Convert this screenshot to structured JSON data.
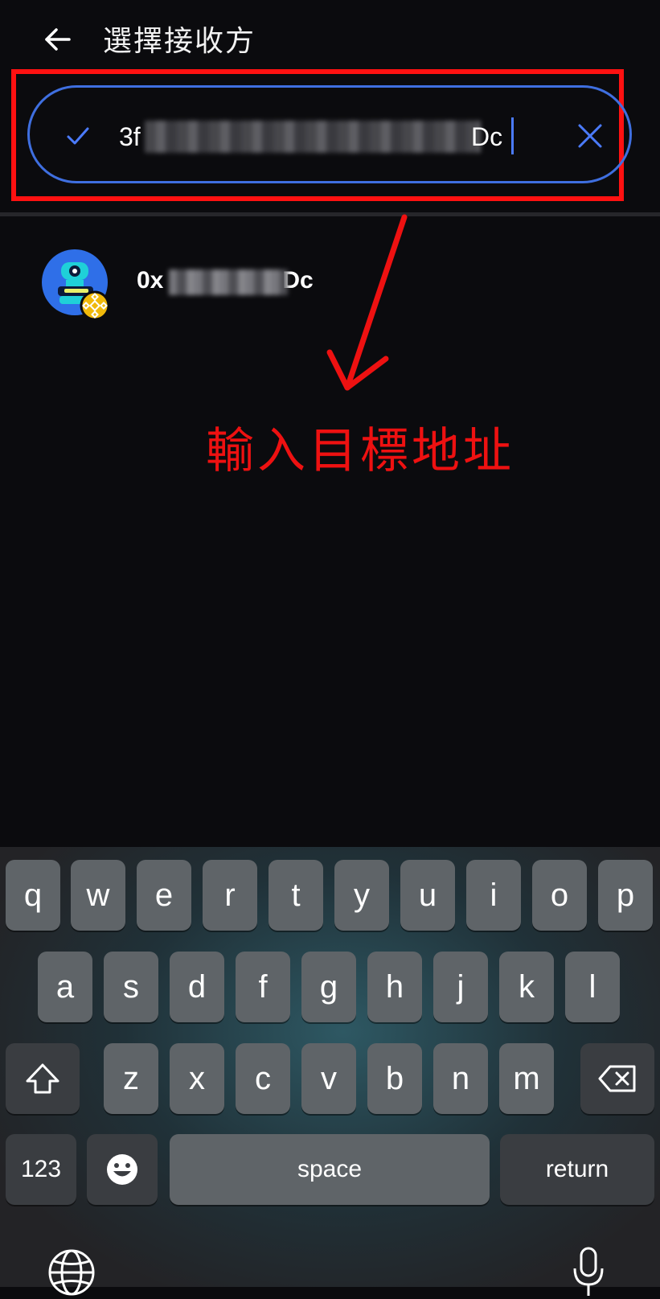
{
  "header": {
    "title": "選擇接收方",
    "back_icon": "arrow-left-icon"
  },
  "search": {
    "value": "3f",
    "suffix": "Dc",
    "check_icon": "checkmark-icon",
    "clear_icon": "close-icon"
  },
  "result": {
    "address_prefix": "0x",
    "address_suffix": "Dc",
    "avatar_icon": "robot-avatar-icon",
    "chain_badge_icon": "bnb-chain-icon"
  },
  "annotation": {
    "text": "輸入目標地址",
    "color": "#ee1111"
  },
  "keyboard": {
    "row1": [
      "q",
      "w",
      "e",
      "r",
      "t",
      "y",
      "u",
      "i",
      "o",
      "p"
    ],
    "row2": [
      "a",
      "s",
      "d",
      "f",
      "g",
      "h",
      "j",
      "k",
      "l"
    ],
    "row3": [
      "z",
      "x",
      "c",
      "v",
      "b",
      "n",
      "m"
    ],
    "numbers_label": "123",
    "space_label": "space",
    "return_label": "return"
  },
  "colors": {
    "accent": "#3f6fe0",
    "background": "#0b0b0e",
    "annotation_red": "#ff1111"
  }
}
